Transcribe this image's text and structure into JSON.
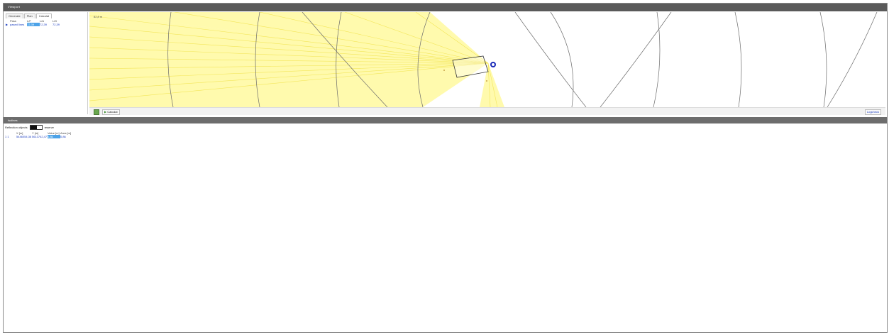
{
  "window": {
    "title": "Viewport"
  },
  "left_panel": {
    "tabs": [
      "Generate",
      "Plan",
      "Calculat"
    ],
    "columns": [
      "Pass",
      "L/F",
      "L/A",
      "L/D"
    ],
    "rows": [
      {
        "marker": "▶",
        "name": "pased lines",
        "lf": "72,39",
        "la": "72,39",
        "ld": "72,39"
      }
    ]
  },
  "viewport": {
    "corner_label": "82,8 m"
  },
  "toolbar": {
    "calculate_label": "Calculat",
    "right_button": "Logcheck"
  },
  "results": {
    "title": "Isolines",
    "settings_label": "Reflection objects",
    "settings_after": "reserve",
    "columns": [
      "",
      "X [m]",
      "Y [m]",
      "Value [m]",
      "Area [m]"
    ],
    "rows": [
      {
        "id": "1 1",
        "x": "5446054,36",
        "y": "5613742,47",
        "value": "0,86",
        "area": "0,86"
      }
    ]
  },
  "colors": {
    "accent": "#1a3cc0",
    "selection": "#4da3e8",
    "beam": "#ffff66"
  }
}
